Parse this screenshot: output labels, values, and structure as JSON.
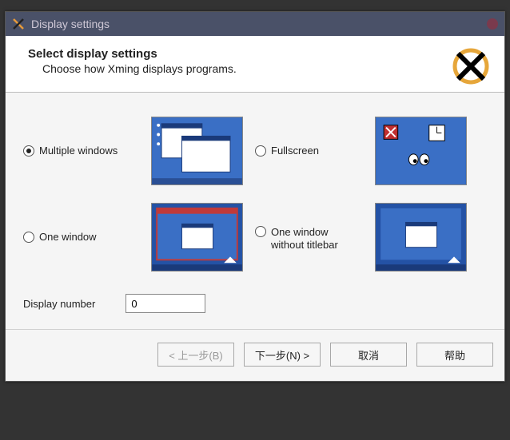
{
  "window": {
    "title": "Display settings"
  },
  "header": {
    "title": "Select display settings",
    "subtitle": "Choose how Xming displays programs."
  },
  "options": {
    "multiple_windows": {
      "label": "Multiple windows",
      "selected": true
    },
    "fullscreen": {
      "label": "Fullscreen",
      "selected": false
    },
    "one_window": {
      "label": "One window",
      "selected": false
    },
    "one_window_no_titlebar": {
      "label": "One window\nwithout titlebar",
      "selected": false
    }
  },
  "display_number": {
    "label": "Display number",
    "value": "0"
  },
  "buttons": {
    "back": "< 上一步(B)",
    "next": "下一步(N) >",
    "cancel": "取消",
    "help": "帮助"
  }
}
